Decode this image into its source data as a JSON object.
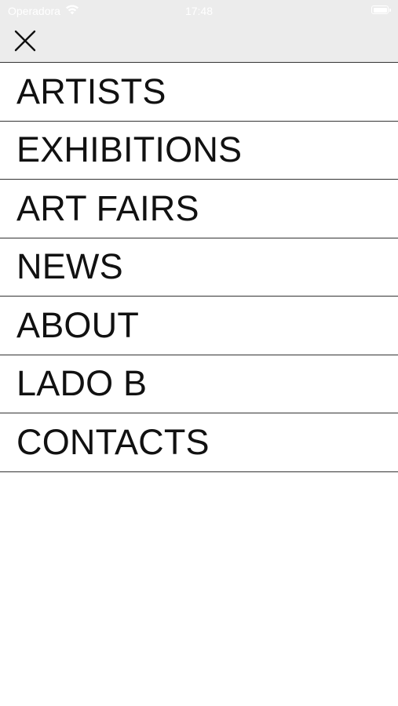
{
  "status_bar": {
    "carrier": "Operadora",
    "time": "17:48",
    "battery_level": 1.0
  },
  "nav": {
    "close_icon": "close-x-icon"
  },
  "menu": {
    "items": [
      {
        "label": "ARTISTS"
      },
      {
        "label": "EXHIBITIONS"
      },
      {
        "label": "ART FAIRS"
      },
      {
        "label": "NEWS"
      },
      {
        "label": "ABOUT"
      },
      {
        "label": "LADO B"
      },
      {
        "label": "CONTACTS"
      }
    ]
  },
  "colors": {
    "chrome_background": "#ececec",
    "divider": "#333333",
    "text": "#111111",
    "background": "#ffffff"
  }
}
